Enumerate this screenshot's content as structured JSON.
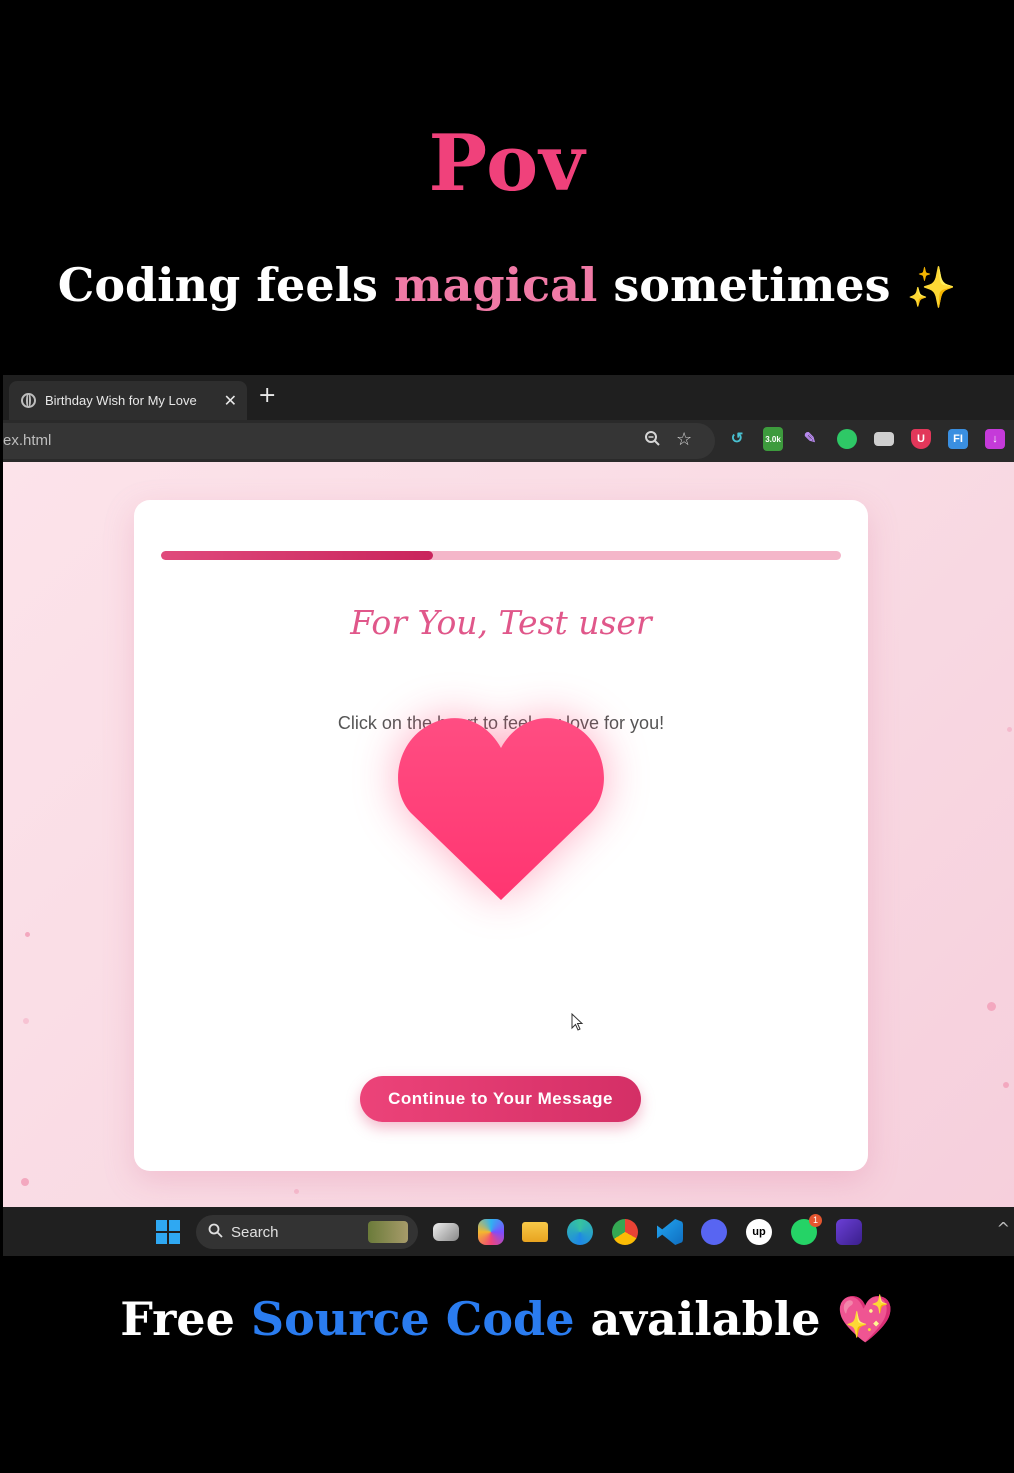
{
  "caption": {
    "title": "Pov",
    "line_part1": "Coding feels",
    "line_highlight": "magical",
    "line_part2": "sometimes",
    "line_emoji": "✨",
    "bottom_part1": "Free",
    "bottom_highlight": "Source Code",
    "bottom_part2": "available",
    "bottom_emoji": "💖"
  },
  "browser": {
    "tab_title": "Birthday Wish for My Love",
    "tab_close": "✕",
    "new_tab": "+",
    "url": "ex.html",
    "zoom_icon": "zoom-icon",
    "star_icon": "bookmark-star-icon",
    "extension_badge": "3.0k"
  },
  "page": {
    "progress": 0.4,
    "title": "For You, Test user",
    "instruction": "Click on the heart to feel my love for you!",
    "continue_label": "Continue to Your Message"
  },
  "taskbar": {
    "search_placeholder": "Search",
    "whatsapp_badge": "1"
  },
  "colors": {
    "accent_pink": "#f0417b",
    "heart": "#ff3f78",
    "highlight_blue": "#2a7cf0"
  }
}
